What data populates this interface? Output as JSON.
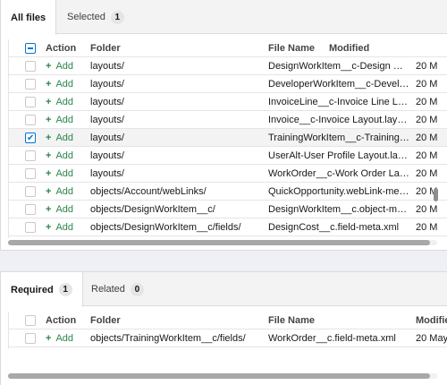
{
  "top": {
    "tabs": [
      {
        "label": "All files",
        "count": null
      },
      {
        "label": "Selected",
        "count": "1"
      }
    ],
    "columns": {
      "action": "Action",
      "folder": "Folder",
      "file": "File Name",
      "modified": "Modified"
    },
    "rows": [
      {
        "checked": false,
        "action": "Add",
        "folder": "layouts/",
        "file": "DesignWorkItem__c-Design Work ...",
        "date": "20 M"
      },
      {
        "checked": false,
        "action": "Add",
        "folder": "layouts/",
        "file": "DeveloperWorkItem__c-Developer...",
        "date": "20 M"
      },
      {
        "checked": false,
        "action": "Add",
        "folder": "layouts/",
        "file": "InvoiceLine__c-Invoice Line Layou...",
        "date": "20 M"
      },
      {
        "checked": false,
        "action": "Add",
        "folder": "layouts/",
        "file": "Invoice__c-Invoice Layout.layout",
        "date": "20 M"
      },
      {
        "checked": true,
        "action": "Add",
        "folder": "layouts/",
        "file": "TrainingWorkItem__c-Training Wor...",
        "date": "20 M"
      },
      {
        "checked": false,
        "action": "Add",
        "folder": "layouts/",
        "file": "UserAlt-User Profile Layout.layout",
        "date": "20 M"
      },
      {
        "checked": false,
        "action": "Add",
        "folder": "layouts/",
        "file": "WorkOrder__c-Work Order Layout...",
        "date": "20 M"
      },
      {
        "checked": false,
        "action": "Add",
        "folder": "objects/Account/webLinks/",
        "file": "QuickOpportunity.webLink-meta.x...",
        "date": "20 M"
      },
      {
        "checked": false,
        "action": "Add",
        "folder": "objects/DesignWorkItem__c/",
        "file": "DesignWorkItem__c.object-meta.x...",
        "date": "20 M"
      },
      {
        "checked": false,
        "action": "Add",
        "folder": "objects/DesignWorkItem__c/fields/",
        "file": "DesignCost__c.field-meta.xml",
        "date": "20 M"
      }
    ]
  },
  "bottom": {
    "tabs": [
      {
        "label": "Required",
        "count": "1"
      },
      {
        "label": "Related",
        "count": "0"
      }
    ],
    "columns": {
      "action": "Action",
      "folder": "Folder",
      "file": "File Name",
      "modified": "Modifie"
    },
    "rows": [
      {
        "checked": false,
        "action": "Add",
        "folder": "objects/TrainingWorkItem__c/fields/",
        "file": "WorkOrder__c.field-meta.xml",
        "date": "20 May"
      }
    ]
  },
  "colors": {
    "accent": "#0176d3",
    "add": "#2e844a"
  }
}
